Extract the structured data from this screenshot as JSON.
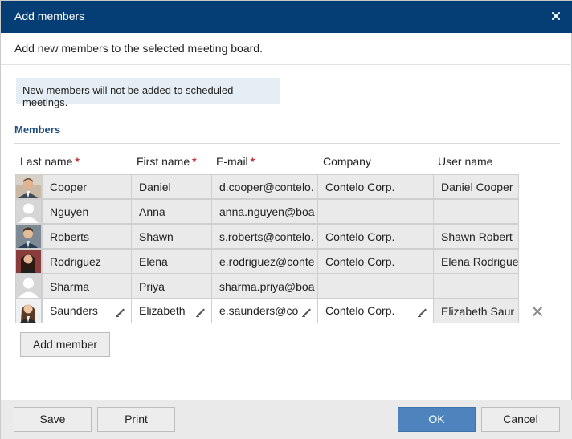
{
  "dialog": {
    "title": "Add members",
    "close_icon": "close-icon",
    "description": "Add new members to the selected meeting board.",
    "info": "New members will not be added to scheduled meetings."
  },
  "members": {
    "section_title": "Members",
    "columns": [
      {
        "label": "Last name",
        "required": "*"
      },
      {
        "label": "First name",
        "required": "*"
      },
      {
        "label": "E-mail",
        "required": "*"
      },
      {
        "label": "Company",
        "required": ""
      },
      {
        "label": "User name",
        "required": ""
      }
    ],
    "rows": [
      {
        "avatar": "photo",
        "last": "Cooper",
        "first": "Daniel",
        "email": "d.cooper@contelo.",
        "company": "Contelo Corp.",
        "user": "Daniel Cooper"
      },
      {
        "avatar": "placeholder",
        "last": "Nguyen",
        "first": "Anna",
        "email": "anna.nguyen@boa",
        "company": "",
        "user": ""
      },
      {
        "avatar": "photo",
        "last": "Roberts",
        "first": "Shawn",
        "email": "s.roberts@contelo.",
        "company": "Contelo Corp.",
        "user": "Shawn Robert"
      },
      {
        "avatar": "photo",
        "last": "Rodriguez",
        "first": "Elena",
        "email": "e.rodriguez@conte",
        "company": "Contelo Corp.",
        "user": "Elena Rodrigue"
      },
      {
        "avatar": "placeholder",
        "last": "Sharma",
        "first": "Priya",
        "email": "sharma.priya@boa",
        "company": "",
        "user": ""
      },
      {
        "avatar": "photo",
        "last": "Saunders",
        "first": "Elizabeth",
        "email": "e.saunders@co",
        "company": "Contelo Corp.",
        "user": "Elizabeth Saur"
      }
    ],
    "edit_icon": "pencil-icon",
    "remove_icon": "remove-icon",
    "add_button": "Add member"
  },
  "footer": {
    "save": "Save",
    "print": "Print",
    "ok": "OK",
    "cancel": "Cancel"
  },
  "colors": {
    "titlebar": "#053d75",
    "accent": "#1f4f82",
    "primary_button": "#4d84bd",
    "required": "#c0282e",
    "info_bg": "#e6eef5"
  }
}
